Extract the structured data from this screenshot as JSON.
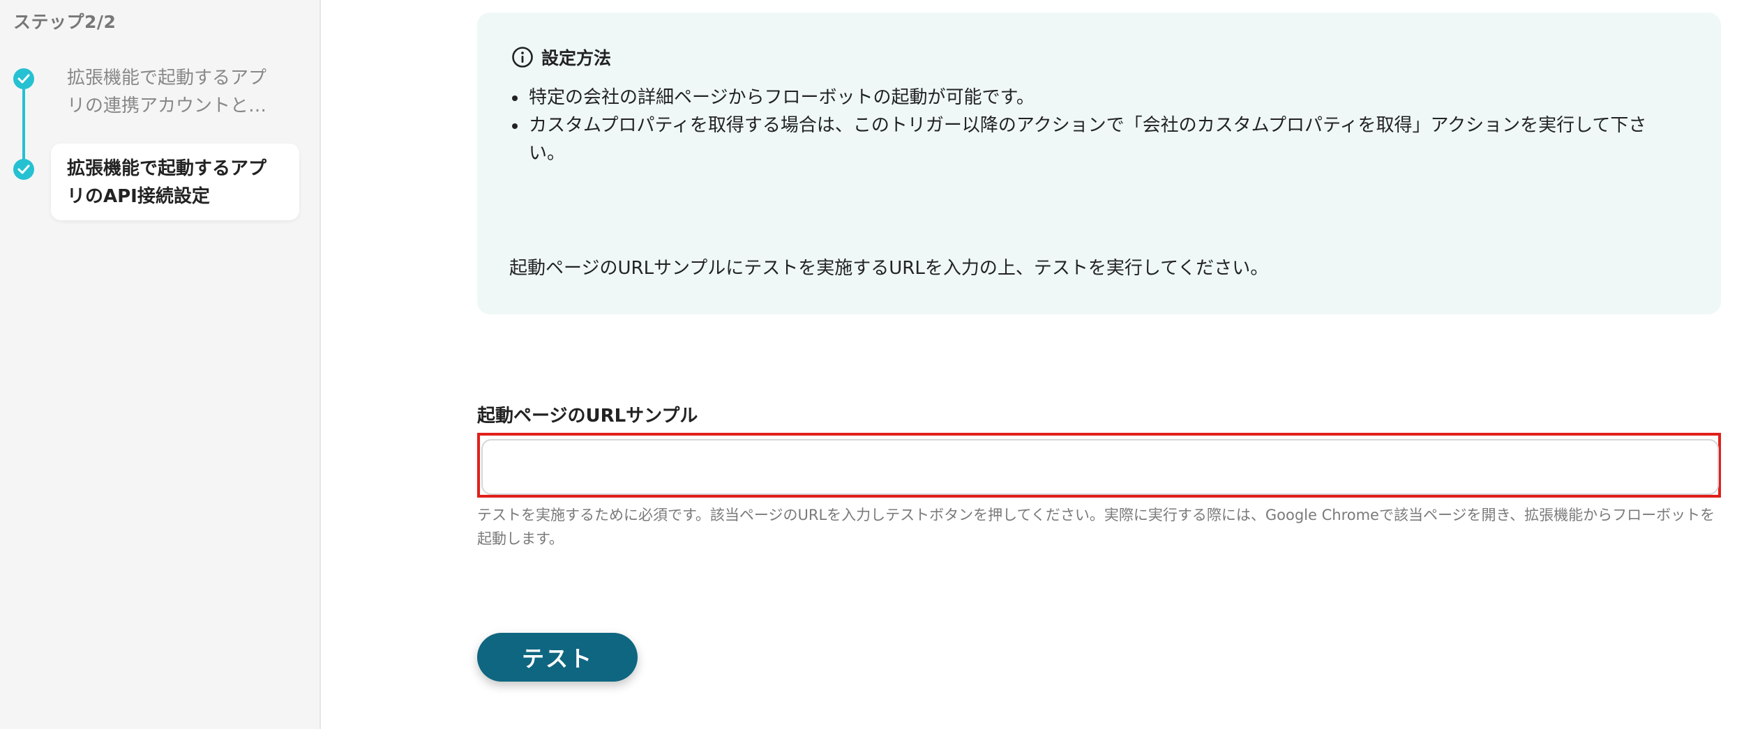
{
  "sidebar": {
    "step_heading": "ステップ2/2",
    "steps": [
      {
        "label_line1": "拡張機能で起動するアプ",
        "label_line2": "リの連携アカウントと…",
        "status": "completed"
      },
      {
        "label_line1": "拡張機能で起動するアプ",
        "label_line2": "リのAPI接続設定",
        "status": "current"
      }
    ],
    "accent_color": "#25c1d2"
  },
  "info_box": {
    "title": "設定方法",
    "icon": "info-circle-icon",
    "bullets": [
      "特定の会社の詳細ページからフローボットの起動が可能です。",
      "カスタムプロパティを取得する場合は、このトリガー以降のアクションで「会社のカスタムプロパティを取得」アクションを実行して下さい。"
    ],
    "note": "起動ページのURLサンプルにテストを実施するURLを入力の上、テストを実行してください。",
    "background": "#eff8f7"
  },
  "url_field": {
    "label": "起動ページのURLサンプル",
    "value": "",
    "placeholder": "",
    "helper": "テストを実施するために必須です。該当ページのURLを入力しテストボタンを押してください。実際に実行する際には、Google Chromeで該当ページを開き、拡張機能からフローボットを起動します。",
    "highlight_color": "#e0201b"
  },
  "test_button": {
    "label": "テスト",
    "color": "#0f6680"
  }
}
